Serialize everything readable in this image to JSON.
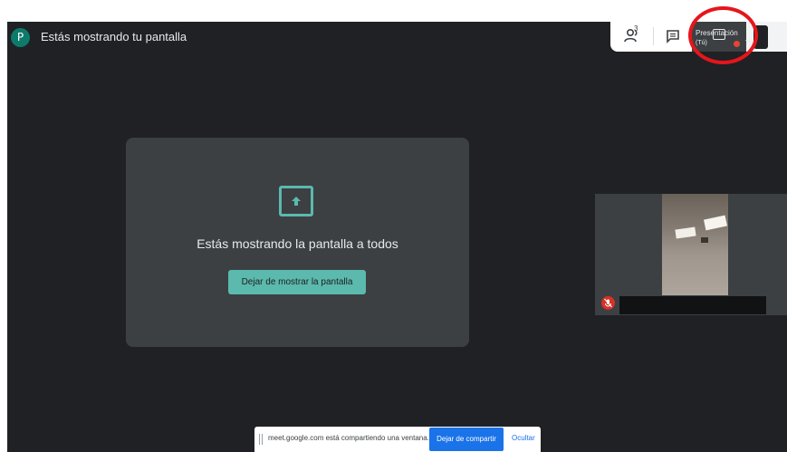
{
  "header": {
    "avatar_initial": "P",
    "title": "Estás mostrando tu pantalla"
  },
  "topbar": {
    "people_icon": "people-icon",
    "people_count": "3",
    "chat_icon": "chat-icon",
    "presentation_label": "Presentación",
    "presentation_sub": "(Tú)",
    "self_label": "Tú",
    "highlight_color": "#e6151c"
  },
  "share_card": {
    "icon": "present-to-all-icon",
    "message": "Estás mostrando la pantalla a todos",
    "stop_label": "Dejar de mostrar la pantalla",
    "accent": "#5bb9ad"
  },
  "participant": {
    "mic_icon": "mic-off-icon"
  },
  "share_bar": {
    "text": "meet.google.com está compartiendo una ventana.",
    "stop_label": "Dejar de compartir",
    "hide_label": "Ocultar"
  }
}
